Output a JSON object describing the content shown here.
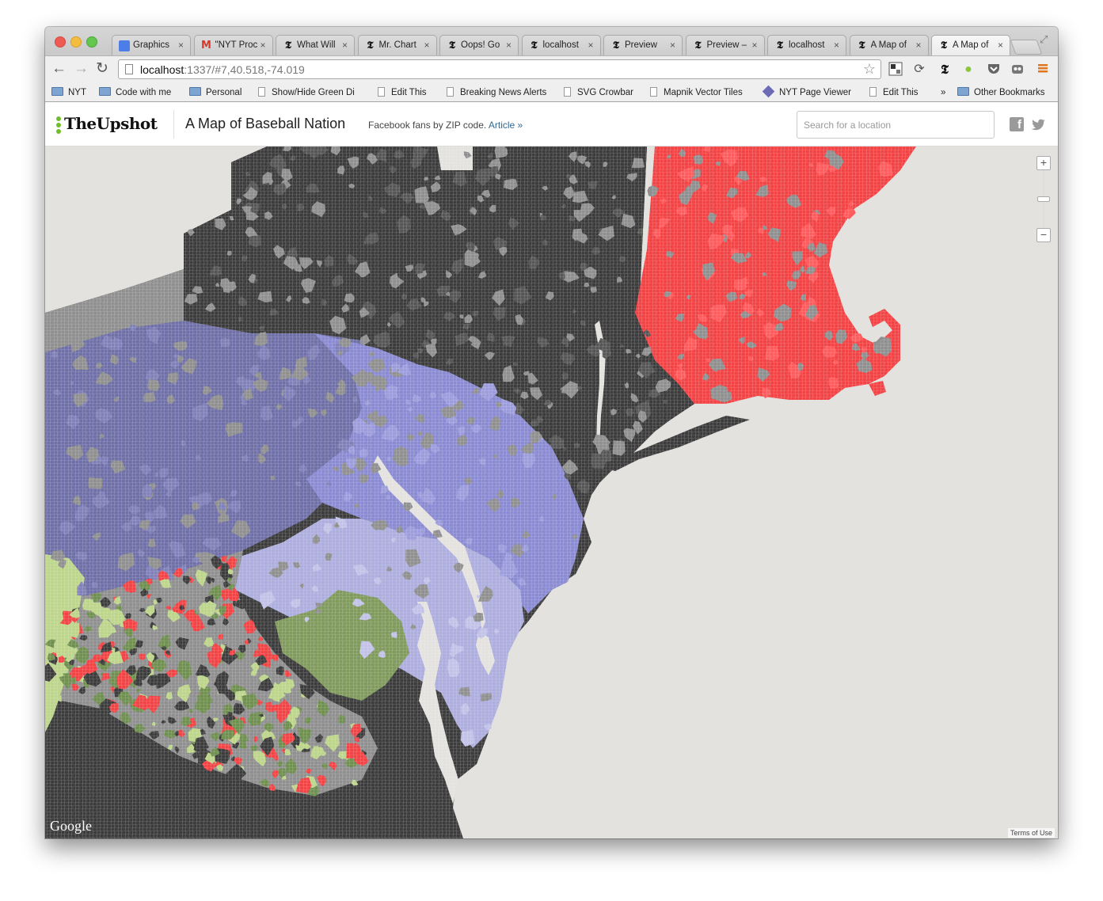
{
  "browser": {
    "tabs": [
      {
        "label": "Graphics",
        "icon": "google-docs-icon"
      },
      {
        "label": "\"NYT Proc",
        "icon": "gmail-icon"
      },
      {
        "label": "What Will",
        "icon": "nyt-icon"
      },
      {
        "label": "Mr. Chart",
        "icon": "nyt-icon"
      },
      {
        "label": "Oops! Go",
        "icon": "nyt-icon"
      },
      {
        "label": "localhost",
        "icon": "nyt-icon"
      },
      {
        "label": "Preview",
        "icon": "nyt-icon"
      },
      {
        "label": "Preview –",
        "icon": "nyt-icon"
      },
      {
        "label": "localhost",
        "icon": "nyt-icon"
      },
      {
        "label": "A Map of",
        "icon": "nyt-icon"
      },
      {
        "label": "A Map of",
        "icon": "nyt-icon",
        "active": true
      }
    ],
    "url_host": "localhost",
    "url_rest": ":1337/#7,40.518,-74.019",
    "bookmarks": [
      {
        "label": "NYT",
        "type": "folder"
      },
      {
        "label": "Code with me",
        "type": "folder"
      },
      {
        "label": "Personal",
        "type": "folder"
      },
      {
        "label": "Show/Hide Green Di",
        "type": "page"
      },
      {
        "label": "Edit This",
        "type": "page"
      },
      {
        "label": "Breaking News Alerts",
        "type": "page"
      },
      {
        "label": "SVG Crowbar",
        "type": "page"
      },
      {
        "label": "Mapnik Vector Tiles",
        "type": "page"
      },
      {
        "label": "NYT Page Viewer",
        "type": "diamond"
      },
      {
        "label": "Edit This",
        "type": "page"
      },
      {
        "label": "»",
        "type": "overflow"
      },
      {
        "label": "Other Bookmarks",
        "type": "folder"
      }
    ]
  },
  "page": {
    "logo": "TheUpshot",
    "title": "A Map of Baseball Nation",
    "subtitle": "Facebook fans by ZIP code.",
    "article_link": "Article »",
    "search_placeholder": "Search for a location"
  },
  "map": {
    "zoom_in": "+",
    "zoom_out": "−",
    "attribution": "Google",
    "terms": "Terms of Use",
    "colors": {
      "water": "#e4e2df",
      "red_sox": "#f24244",
      "yankees": "#3b3b3b",
      "mixed": "#8f8f8f",
      "phillies_west": "#6f6fa8",
      "phillies": "#8a8ad2",
      "orioles_light": "#adadde",
      "nationals": "#7f9a5c",
      "light_green": "#bcd58a"
    }
  }
}
